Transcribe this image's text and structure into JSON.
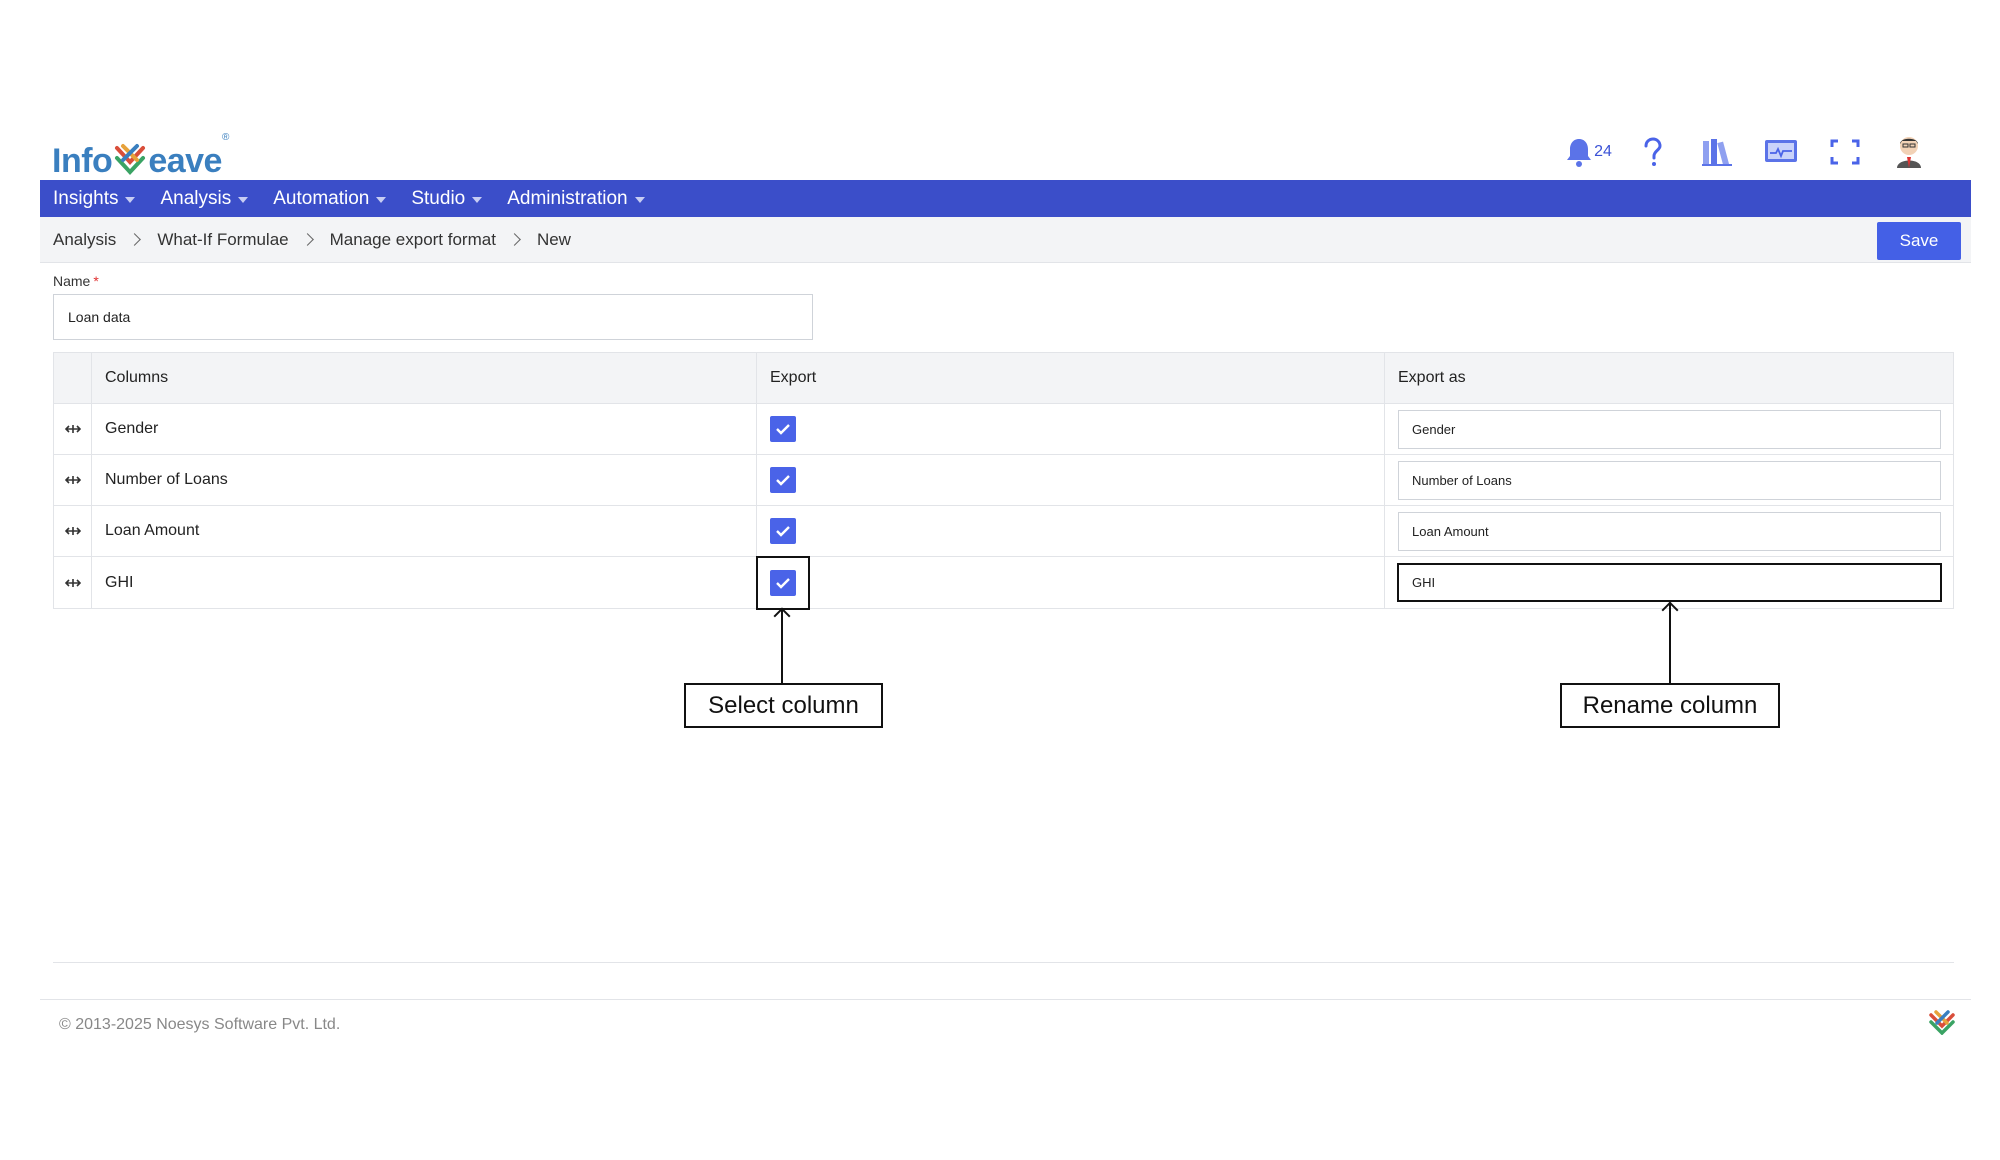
{
  "brand": {
    "logo_text_left": "Info",
    "logo_text_right": "eave"
  },
  "header": {
    "notification_count": "24",
    "icons": [
      "bell-icon",
      "help-icon",
      "library-icon",
      "monitor-icon",
      "fullscreen-icon",
      "user-avatar"
    ]
  },
  "nav": {
    "items": [
      {
        "label": "Insights"
      },
      {
        "label": "Analysis"
      },
      {
        "label": "Automation"
      },
      {
        "label": "Studio"
      },
      {
        "label": "Administration"
      }
    ]
  },
  "breadcrumb": {
    "items": [
      "Analysis",
      "What-If Formulae",
      "Manage export format",
      "New"
    ]
  },
  "toolbar": {
    "save_label": "Save"
  },
  "form": {
    "name_label": "Name",
    "required_mark": "*",
    "name_value": "Loan data"
  },
  "table": {
    "headers": {
      "columns": "Columns",
      "export": "Export",
      "export_as": "Export as"
    },
    "rows": [
      {
        "column": "Gender",
        "export": true,
        "export_as": "Gender"
      },
      {
        "column": "Number of Loans",
        "export": true,
        "export_as": "Number of Loans"
      },
      {
        "column": "Loan Amount",
        "export": true,
        "export_as": "Loan Amount"
      },
      {
        "column": "GHI",
        "export": true,
        "export_as": "GHI"
      }
    ]
  },
  "annotations": {
    "select_column": "Select column",
    "rename_column": "Rename column"
  },
  "footer": {
    "copyright": "© 2013-2025 Noesys Software Pvt. Ltd."
  },
  "colors": {
    "nav_bg": "#3b4ec9",
    "accent": "#4460e6",
    "checkbox": "#4a63e8"
  }
}
